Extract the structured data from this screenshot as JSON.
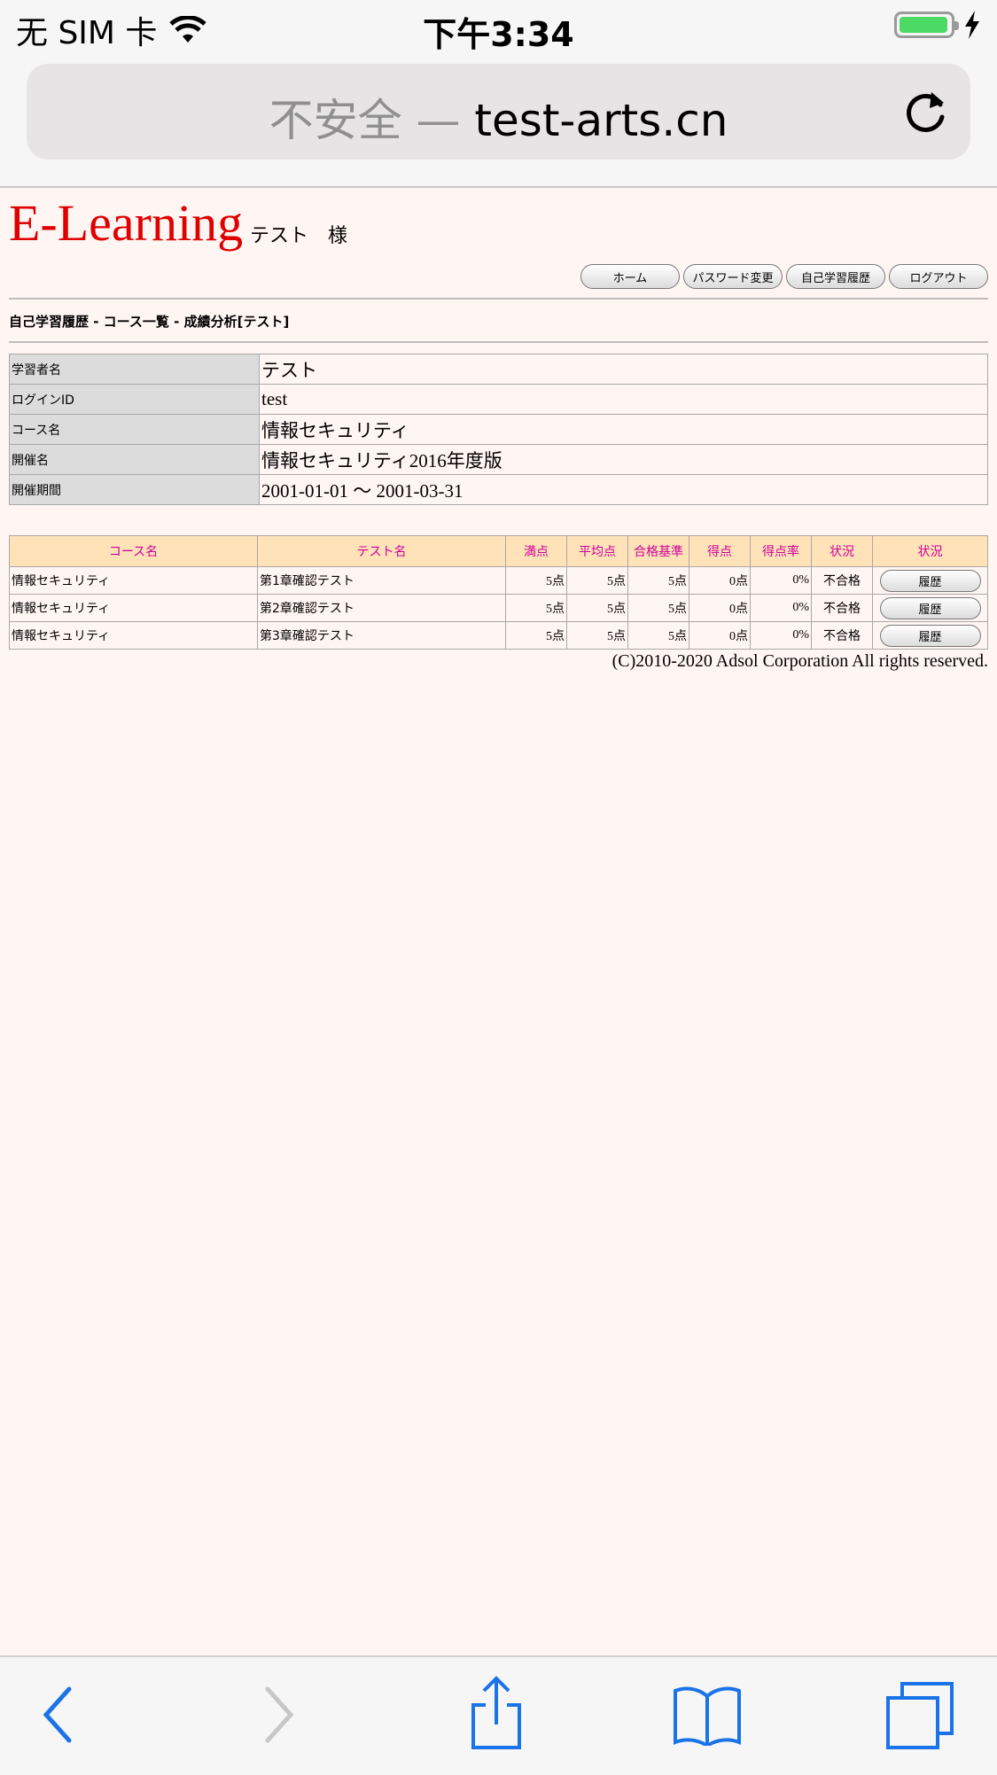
{
  "status_bar": {
    "carrier": "无 SIM 卡",
    "time": "下午3:34",
    "battery_color": "#4cd964"
  },
  "address_bar": {
    "insecure_label": "不安全 —",
    "host": "test-arts.cn"
  },
  "header": {
    "brand": "E-Learning",
    "user": "テスト　様"
  },
  "nav": [
    "ホーム",
    "パスワード変更",
    "自己学習履歴",
    "ログアウト"
  ],
  "breadcrumb": "自己学習履歴 - コース一覧 - 成績分析[テスト]",
  "info": [
    {
      "label": "学習者名",
      "value": "テスト"
    },
    {
      "label": "ログインID",
      "value": "test"
    },
    {
      "label": "コース名",
      "value": "情報セキュリティ"
    },
    {
      "label": "開催名",
      "value": "情報セキュリティ2016年度版"
    },
    {
      "label": "開催期間",
      "value": "2001-01-01 ～ 2001-03-31"
    }
  ],
  "results": {
    "headers": [
      "コース名",
      "テスト名",
      "満点",
      "平均点",
      "合格基準",
      "得点",
      "得点率",
      "状況",
      "状況"
    ],
    "rows": [
      {
        "course": "情報セキュリティ",
        "test": "第1章確認テスト",
        "full": "5点",
        "avg": "5点",
        "pass": "5点",
        "score": "0点",
        "rate": "0%",
        "status": "不合格",
        "action": "履歴"
      },
      {
        "course": "情報セキュリティ",
        "test": "第2章確認テスト",
        "full": "5点",
        "avg": "5点",
        "pass": "5点",
        "score": "0点",
        "rate": "0%",
        "status": "不合格",
        "action": "履歴"
      },
      {
        "course": "情報セキュリティ",
        "test": "第3章確認テスト",
        "full": "5点",
        "avg": "5点",
        "pass": "5点",
        "score": "0点",
        "rate": "0%",
        "status": "不合格",
        "action": "履歴"
      }
    ]
  },
  "copyright": "(C)2010-2020 Adsol Corporation All rights reserved.",
  "toolbar_icons": [
    "back-icon",
    "forward-icon",
    "share-icon",
    "bookmarks-icon",
    "tabs-icon"
  ],
  "accent_color": "#1a73e8"
}
